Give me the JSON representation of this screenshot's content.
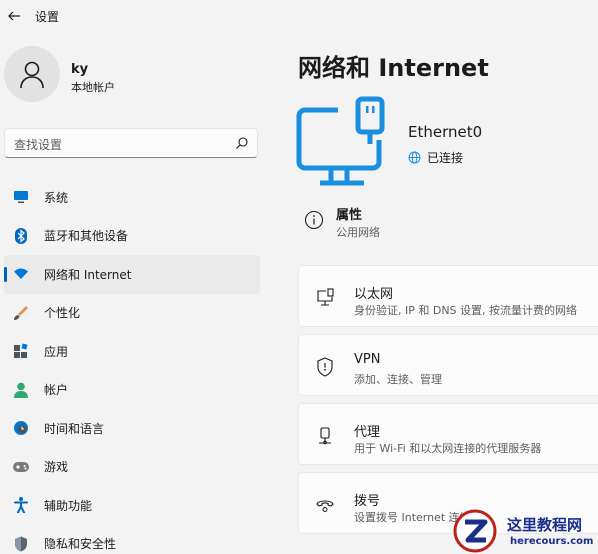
{
  "window": {
    "title": "设置"
  },
  "user": {
    "name": "ky",
    "account_type": "本地帐户"
  },
  "search": {
    "placeholder": "查找设置"
  },
  "sidebar": {
    "items": [
      {
        "label": "系统",
        "icon": "monitor-icon",
        "color": "#0078d4"
      },
      {
        "label": "蓝牙和其他设备",
        "icon": "bluetooth-icon",
        "color": "#0067c0"
      },
      {
        "label": "网络和 Internet",
        "icon": "wifi-icon",
        "color": "#0078d4",
        "selected": true
      },
      {
        "label": "个性化",
        "icon": "brush-icon",
        "color": "#e8914a"
      },
      {
        "label": "应用",
        "icon": "apps-icon",
        "color": "#4a5560"
      },
      {
        "label": "帐户",
        "icon": "person-icon",
        "color": "#2fa86e"
      },
      {
        "label": "时间和语言",
        "icon": "globe-clock-icon",
        "color": "#0078d4"
      },
      {
        "label": "游戏",
        "icon": "gamepad-icon",
        "color": "#7a7a7a"
      },
      {
        "label": "辅助功能",
        "icon": "accessibility-icon",
        "color": "#0067c0"
      },
      {
        "label": "隐私和安全性",
        "icon": "shield-icon",
        "color": "#5a6470"
      }
    ]
  },
  "main": {
    "title": "网络和 Internet",
    "adapter": {
      "name": "Ethernet0",
      "status": "已连接"
    },
    "properties": {
      "title": "属性",
      "subtitle": "公用网络"
    },
    "cards": [
      {
        "title": "以太网",
        "subtitle": "身份验证, IP 和 DNS 设置, 按流量计费的网络",
        "icon": "ethernet-icon"
      },
      {
        "title": "VPN",
        "subtitle": "添加、连接、管理",
        "icon": "vpn-shield-icon"
      },
      {
        "title": "代理",
        "subtitle": "用于 Wi-Fi 和以太网连接的代理服务器",
        "icon": "proxy-icon"
      },
      {
        "title": "拨号",
        "subtitle": "设置拨号 Internet 连接",
        "icon": "dialup-icon"
      }
    ]
  },
  "watermark": {
    "text": "这里教程网",
    "url": "herecours.com"
  },
  "colors": {
    "accent": "#005fb8",
    "hero_blue": "#1a8fe0"
  }
}
